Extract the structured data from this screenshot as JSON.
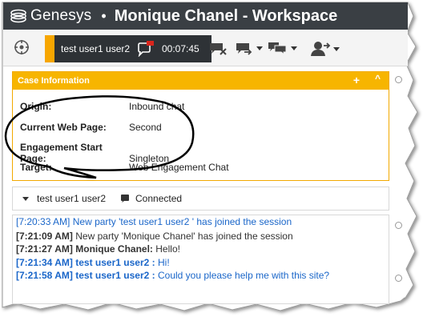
{
  "window": {
    "brand": "Genesys",
    "separator": "•",
    "title": "Monique Chanel - Workspace"
  },
  "toolbar": {
    "interaction_party": "test user1 user2",
    "timer": "00:07:45",
    "icons": [
      "target-icon",
      "chat-icon",
      "end-chat-icon",
      "transfer-icon",
      "consult-icon",
      "party-icon"
    ]
  },
  "case_info": {
    "header": "Case Information",
    "plus": "+",
    "collapse": "^",
    "rows": [
      {
        "label": "Origin:",
        "value": "Inbound chat"
      },
      {
        "label": "Current Web Page:",
        "value": "Second"
      },
      {
        "label": "Engagement Start Page:",
        "value": "Singleton"
      },
      {
        "label": "Target:",
        "value": "Web Engagement Chat"
      }
    ]
  },
  "chat": {
    "party": "test user1 user2",
    "status": "Connected",
    "messages": [
      {
        "time": "[7:20:33 AM]",
        "sender": "",
        "text": "New party 'test user1 user2 ' has joined the session",
        "kind": "agent"
      },
      {
        "time": "[7:21:09 AM]",
        "sender": "",
        "text": "New party 'Monique Chanel' has joined the session",
        "kind": "customer"
      },
      {
        "time": "[7:21:27 AM]",
        "sender": "Monique Chanel:",
        "text": "Hello!",
        "kind": "customer"
      },
      {
        "time": "[7:21:34 AM]",
        "sender": "test user1 user2 :",
        "text": "Hi!",
        "kind": "agent"
      },
      {
        "time": "[7:21:58 AM]",
        "sender": "test user1 user2 :",
        "text": "Could  you please help me with this site?",
        "kind": "agent"
      }
    ]
  },
  "colors": {
    "titlebar": "#3a3f44",
    "accent": "#f7b500",
    "agent_text": "#1a66c9",
    "customer_text": "#333333"
  }
}
